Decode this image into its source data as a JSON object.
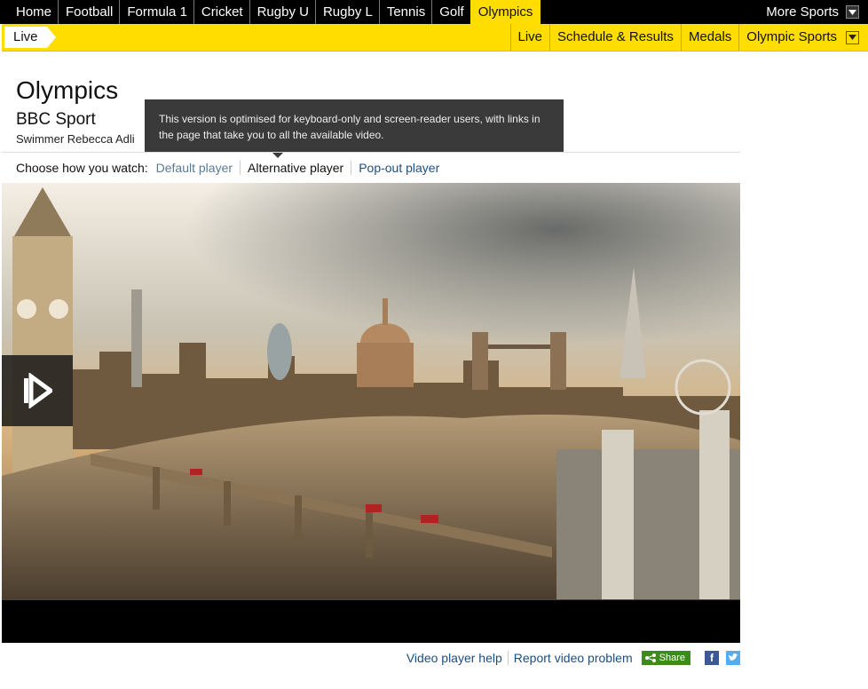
{
  "topnav": {
    "items": [
      "Home",
      "Football",
      "Formula 1",
      "Cricket",
      "Rugby U",
      "Rugby L",
      "Tennis",
      "Golf",
      "Olympics"
    ],
    "active": "Olympics",
    "more_label": "More Sports"
  },
  "subnav": {
    "live_tab": "Live",
    "items": [
      "Live",
      "Schedule & Results",
      "Medals",
      "Olympic Sports"
    ]
  },
  "page": {
    "title": "Olympics",
    "brand": "BBC Sport",
    "caption": "Swimmer Rebecca Adli"
  },
  "tooltip": {
    "text": "This version is optimised for keyboard-only and screen-reader users, with links in the page that take you to all the available video."
  },
  "watch": {
    "label": "Choose how you watch:",
    "options": [
      "Default player",
      "Alternative player",
      "Pop-out player"
    ],
    "selected": "Alternative player"
  },
  "footer": {
    "help": "Video player help",
    "report": "Report video problem",
    "share": "Share"
  },
  "colors": {
    "accent": "#ffdd00",
    "nav_bg": "#000000",
    "link": "#1c4e80",
    "share_green": "#3e8a1d"
  },
  "icons": {
    "more_sports_dropdown": "chevron-down-icon",
    "subnav_dropdown": "chevron-down-icon",
    "play": "play-icon",
    "share": "share-icon",
    "facebook": "facebook-icon",
    "twitter": "twitter-icon"
  }
}
